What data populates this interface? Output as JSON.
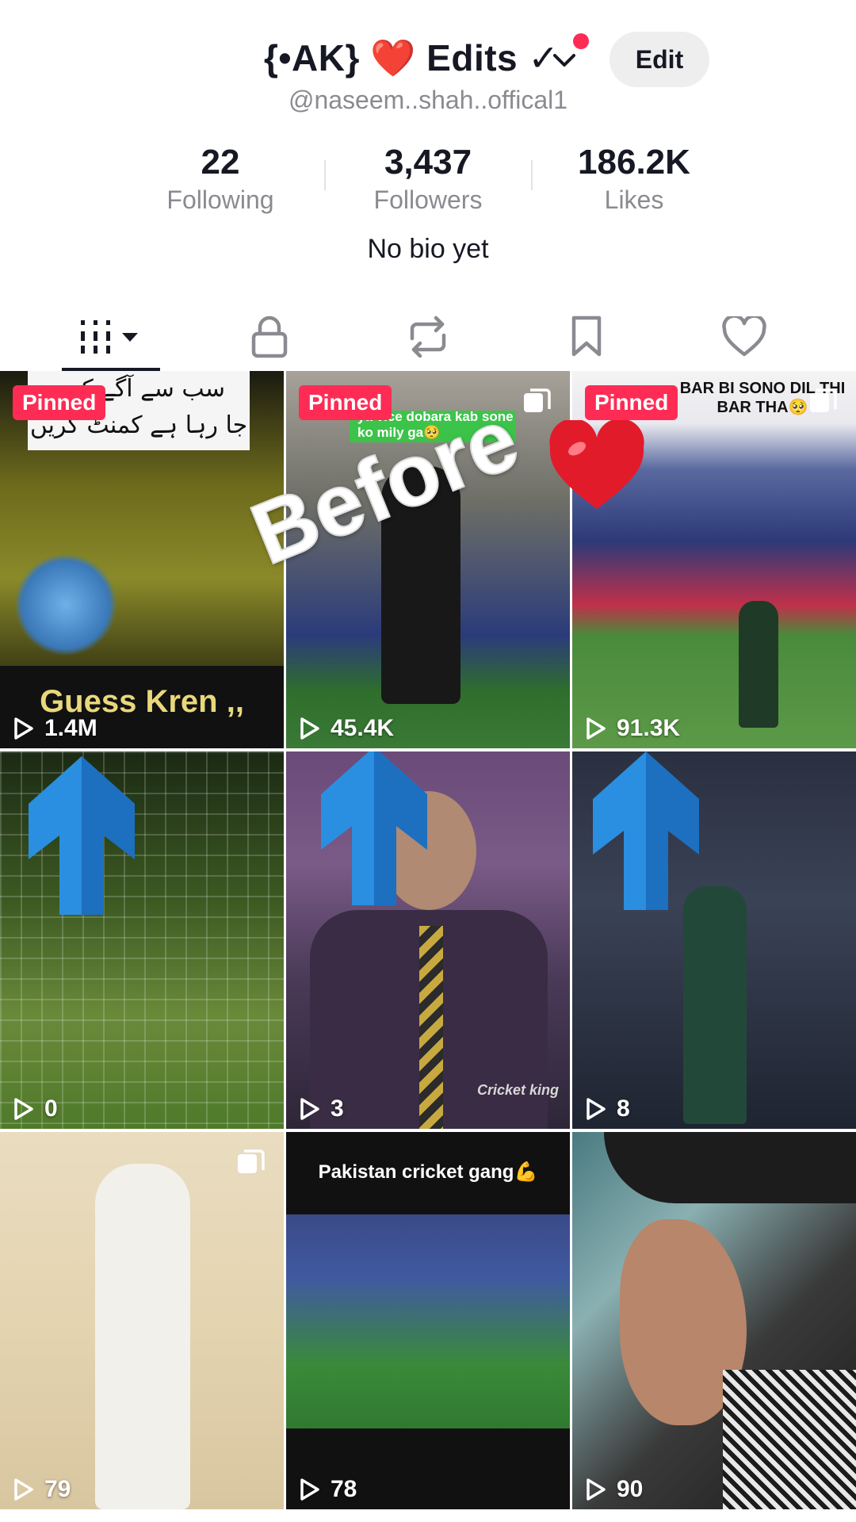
{
  "profile": {
    "display_name": "{•AK} ❤️ Edits ✓",
    "username": "@naseem..shah..offical1",
    "edit_label": "Edit",
    "bio": "No bio yet",
    "stats": [
      {
        "value": "22",
        "label": "Following"
      },
      {
        "value": "3,437",
        "label": "Followers"
      },
      {
        "value": "186.2K",
        "label": "Likes"
      }
    ]
  },
  "tabs": [
    {
      "name": "videos",
      "icon": "grid-icon",
      "active": true
    },
    {
      "name": "private",
      "icon": "lock-icon"
    },
    {
      "name": "reposts",
      "icon": "repost-icon"
    },
    {
      "name": "favorites",
      "icon": "bookmark-icon"
    },
    {
      "name": "liked",
      "icon": "heart-icon"
    }
  ],
  "pinned_label": "Pinned",
  "overlays": {
    "urdu_line1": "سب سے آگے کون",
    "urdu_line2": "جا رہا ہے کمنٹ کریں",
    "guess": "Guess Kren ,,",
    "before": "Before",
    "tile2_caption": "ya vice dobara kab sone ko mily ga🥺",
    "tile3_caption": "BAR BI SONO DIL THI BAR THA🥺",
    "tile8_caption": "Pakistan cricket gang💪",
    "tile5_watermark": "Cricket king"
  },
  "videos": [
    {
      "views": "1.4M",
      "pinned": true
    },
    {
      "views": "45.4K",
      "pinned": true,
      "multi": true
    },
    {
      "views": "91.3K",
      "pinned": true,
      "multi": true
    },
    {
      "views": "0"
    },
    {
      "views": "3"
    },
    {
      "views": "8"
    },
    {
      "views": "79",
      "multi": true
    },
    {
      "views": "78"
    },
    {
      "views": "90"
    }
  ],
  "colors": {
    "accent": "#fe2c55",
    "text_primary": "#161823",
    "text_secondary": "#8a8b91",
    "arrow_blue": "#2a8fe0"
  }
}
